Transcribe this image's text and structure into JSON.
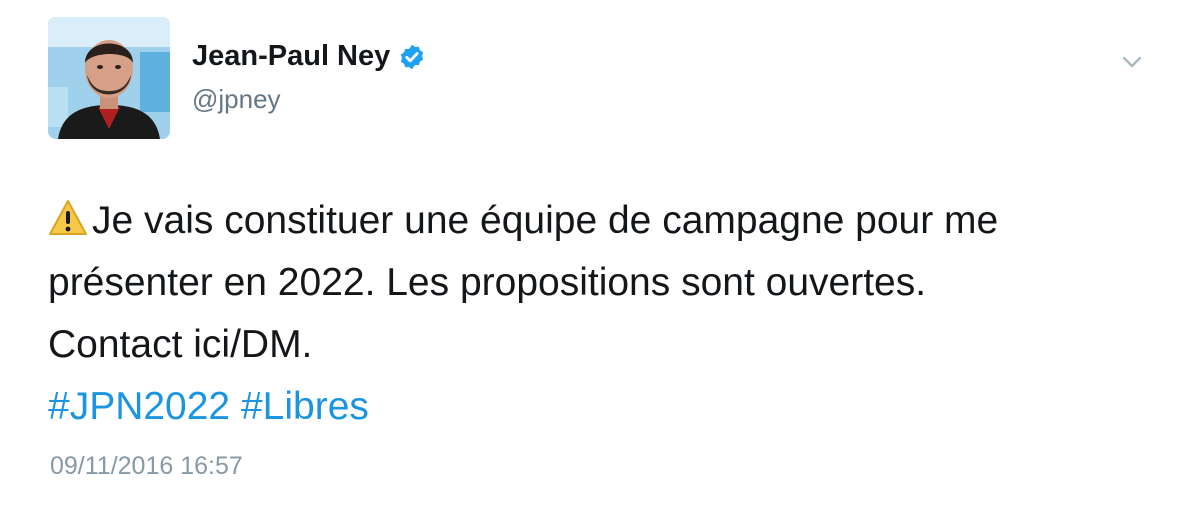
{
  "tweet": {
    "author": {
      "display_name": "Jean-Paul Ney",
      "handle": "@jpney",
      "verified": true
    },
    "text_lines": [
      "Je vais constituer une équipe de campagne pour me",
      "présenter en 2022. Les propositions sont ouvertes.",
      "Contact ici/DM."
    ],
    "hashtags": [
      "#JPN2022",
      "#Libres"
    ],
    "timestamp": "09/11/2016 16:57",
    "leading_emoji": "warning-icon"
  },
  "colors": {
    "text": "#14171a",
    "secondary": "#657786",
    "link": "#1b95e0",
    "verified": "#1da1f2",
    "timestamp": "#8899a6"
  }
}
